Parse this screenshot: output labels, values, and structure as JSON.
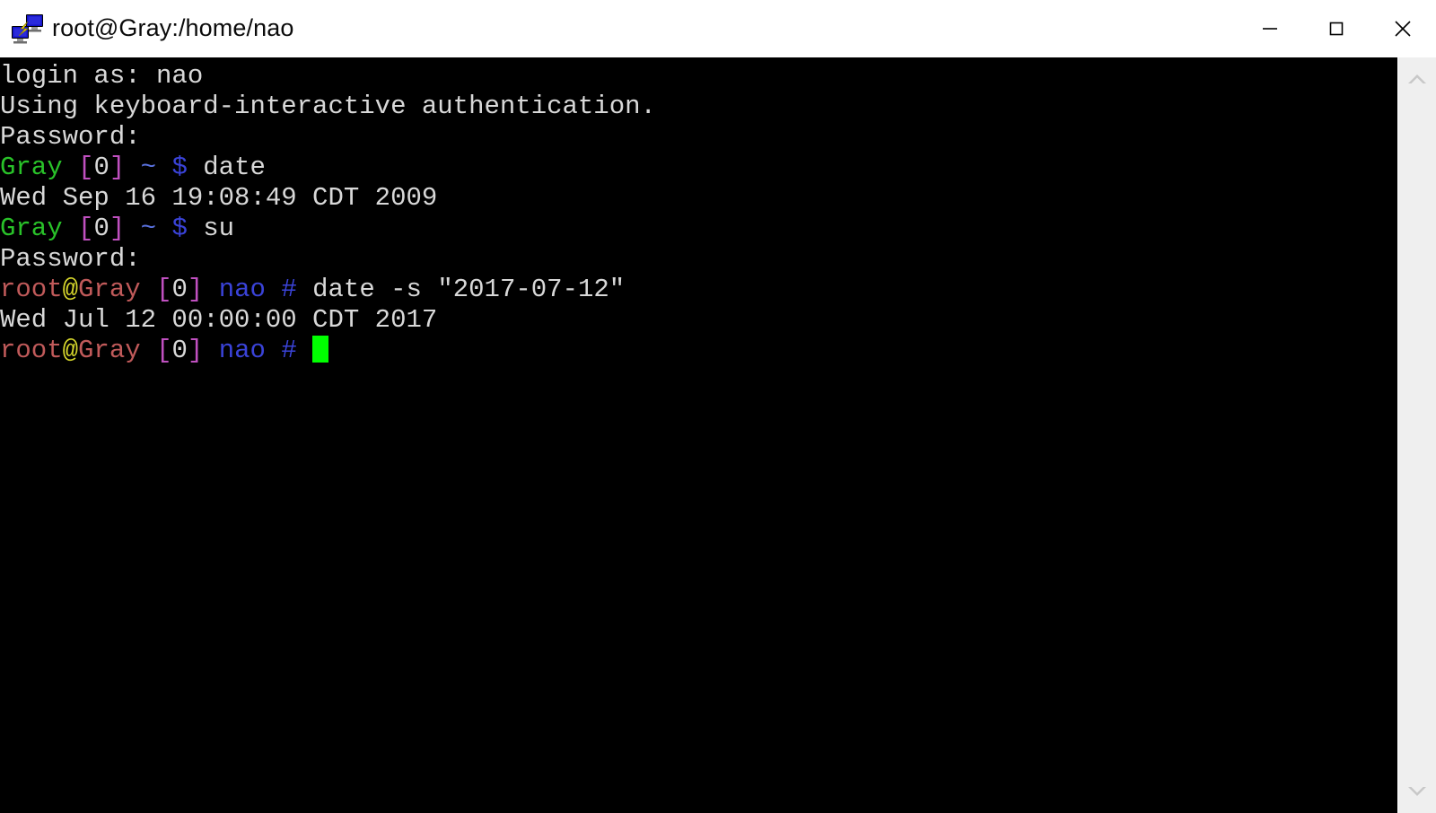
{
  "window": {
    "title": "root@Gray:/home/nao",
    "icon": "putty-icon",
    "background_color": "#000000",
    "titlebar_color": "#ffffff"
  },
  "window_controls": {
    "minimize": {
      "name": "minimize-button",
      "glyph": "minimize-icon"
    },
    "maximize": {
      "name": "maximize-button",
      "glyph": "maximize-icon"
    },
    "close": {
      "name": "close-button",
      "glyph": "close-icon"
    }
  },
  "scrollbar": {
    "up_arrow": "chevron-up-icon",
    "down_arrow": "chevron-down-icon",
    "track_color": "#efefef",
    "arrow_color": "#c8c8c8"
  },
  "terminal": {
    "foreground_color": "#d8d8d8",
    "background_color": "#000000",
    "cursor_color": "#00ff00",
    "palette": {
      "green": "#29c229",
      "magenta": "#c050c0",
      "cyan": "#5a72e0",
      "blue": "#3a43d8",
      "red": "#c05a5a",
      "yellow": "#d6d62c",
      "white": "#d8d8d8"
    },
    "lines": [
      {
        "id": "line-login-as",
        "segments": [
          {
            "text": "login as: nao",
            "color": "white"
          }
        ]
      },
      {
        "id": "line-auth-method",
        "segments": [
          {
            "text": "Using keyboard-interactive authentication.",
            "color": "white"
          }
        ]
      },
      {
        "id": "line-password-1",
        "segments": [
          {
            "text": "Password:",
            "color": "white"
          }
        ]
      },
      {
        "id": "line-prompt-date",
        "segments": [
          {
            "text": "Gray",
            "color": "green"
          },
          {
            "text": " ",
            "color": "white"
          },
          {
            "text": "[",
            "color": "magenta"
          },
          {
            "text": "0",
            "color": "white"
          },
          {
            "text": "]",
            "color": "magenta"
          },
          {
            "text": " ",
            "color": "white"
          },
          {
            "text": "~",
            "color": "cyan"
          },
          {
            "text": " ",
            "color": "white"
          },
          {
            "text": "$",
            "color": "blue"
          },
          {
            "text": " date",
            "color": "white"
          }
        ]
      },
      {
        "id": "line-date-output-1",
        "segments": [
          {
            "text": "Wed Sep 16 19:08:49 CDT 2009",
            "color": "white"
          }
        ]
      },
      {
        "id": "line-prompt-su",
        "segments": [
          {
            "text": "Gray",
            "color": "green"
          },
          {
            "text": " ",
            "color": "white"
          },
          {
            "text": "[",
            "color": "magenta"
          },
          {
            "text": "0",
            "color": "white"
          },
          {
            "text": "]",
            "color": "magenta"
          },
          {
            "text": " ",
            "color": "white"
          },
          {
            "text": "~",
            "color": "cyan"
          },
          {
            "text": " ",
            "color": "white"
          },
          {
            "text": "$",
            "color": "blue"
          },
          {
            "text": " su",
            "color": "white"
          }
        ]
      },
      {
        "id": "line-password-2",
        "segments": [
          {
            "text": "Password:",
            "color": "white"
          }
        ]
      },
      {
        "id": "line-root-prompt-date-set",
        "segments": [
          {
            "text": "root",
            "color": "red"
          },
          {
            "text": "@",
            "color": "yellow"
          },
          {
            "text": "Gray",
            "color": "red"
          },
          {
            "text": " ",
            "color": "white"
          },
          {
            "text": "[",
            "color": "magenta"
          },
          {
            "text": "0",
            "color": "white"
          },
          {
            "text": "]",
            "color": "magenta"
          },
          {
            "text": " ",
            "color": "white"
          },
          {
            "text": "nao",
            "color": "blue"
          },
          {
            "text": " ",
            "color": "white"
          },
          {
            "text": "#",
            "color": "blue"
          },
          {
            "text": " date -s \"2017-07-12\"",
            "color": "white"
          }
        ]
      },
      {
        "id": "line-date-output-2",
        "segments": [
          {
            "text": "Wed Jul 12 00:00:00 CDT 2017",
            "color": "white"
          }
        ]
      },
      {
        "id": "line-root-prompt-current",
        "segments": [
          {
            "text": "root",
            "color": "red"
          },
          {
            "text": "@",
            "color": "yellow"
          },
          {
            "text": "Gray",
            "color": "red"
          },
          {
            "text": " ",
            "color": "white"
          },
          {
            "text": "[",
            "color": "magenta"
          },
          {
            "text": "0",
            "color": "white"
          },
          {
            "text": "]",
            "color": "magenta"
          },
          {
            "text": " ",
            "color": "white"
          },
          {
            "text": "nao",
            "color": "blue"
          },
          {
            "text": " ",
            "color": "white"
          },
          {
            "text": "#",
            "color": "blue"
          },
          {
            "text": " ",
            "color": "white"
          }
        ],
        "cursor": true
      }
    ]
  }
}
